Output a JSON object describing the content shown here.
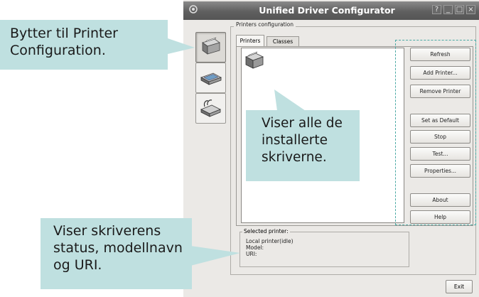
{
  "window": {
    "title": "Unified Driver Configurator",
    "controls": [
      "?",
      "_",
      "□",
      "×"
    ]
  },
  "sidebar": {
    "items": [
      {
        "icon": "printer-icon",
        "active": true
      },
      {
        "icon": "scanner-icon",
        "active": false
      },
      {
        "icon": "port-icon",
        "active": false
      }
    ]
  },
  "printers_config": {
    "legend": "Printers configuration",
    "tabs": [
      "Printers",
      "Classes"
    ]
  },
  "buttons": {
    "refresh": "Refresh",
    "add_printer": "Add Printer...",
    "remove_printer": "Remove Printer",
    "set_default": "Set as Default",
    "stop": "Stop",
    "test": "Test...",
    "properties": "Properties...",
    "about": "About",
    "help": "Help",
    "exit": "Exit"
  },
  "selected_printer": {
    "legend": "Selected printer:",
    "status": "Local printer(idle)",
    "model": "Model:",
    "uri": "URI:"
  },
  "callouts": {
    "top": [
      "Bytter til Printer",
      "Configuration."
    ],
    "middle": [
      "Viser alle de",
      "installerte",
      "skriverne."
    ],
    "bottom": [
      "Viser skriverens",
      "status, modellnavn",
      "og URI."
    ]
  },
  "colors": {
    "callout_bg": "#bfe0e0",
    "dashed_frame": "#4aa9a4",
    "titlebar": "#5f5f5f"
  }
}
